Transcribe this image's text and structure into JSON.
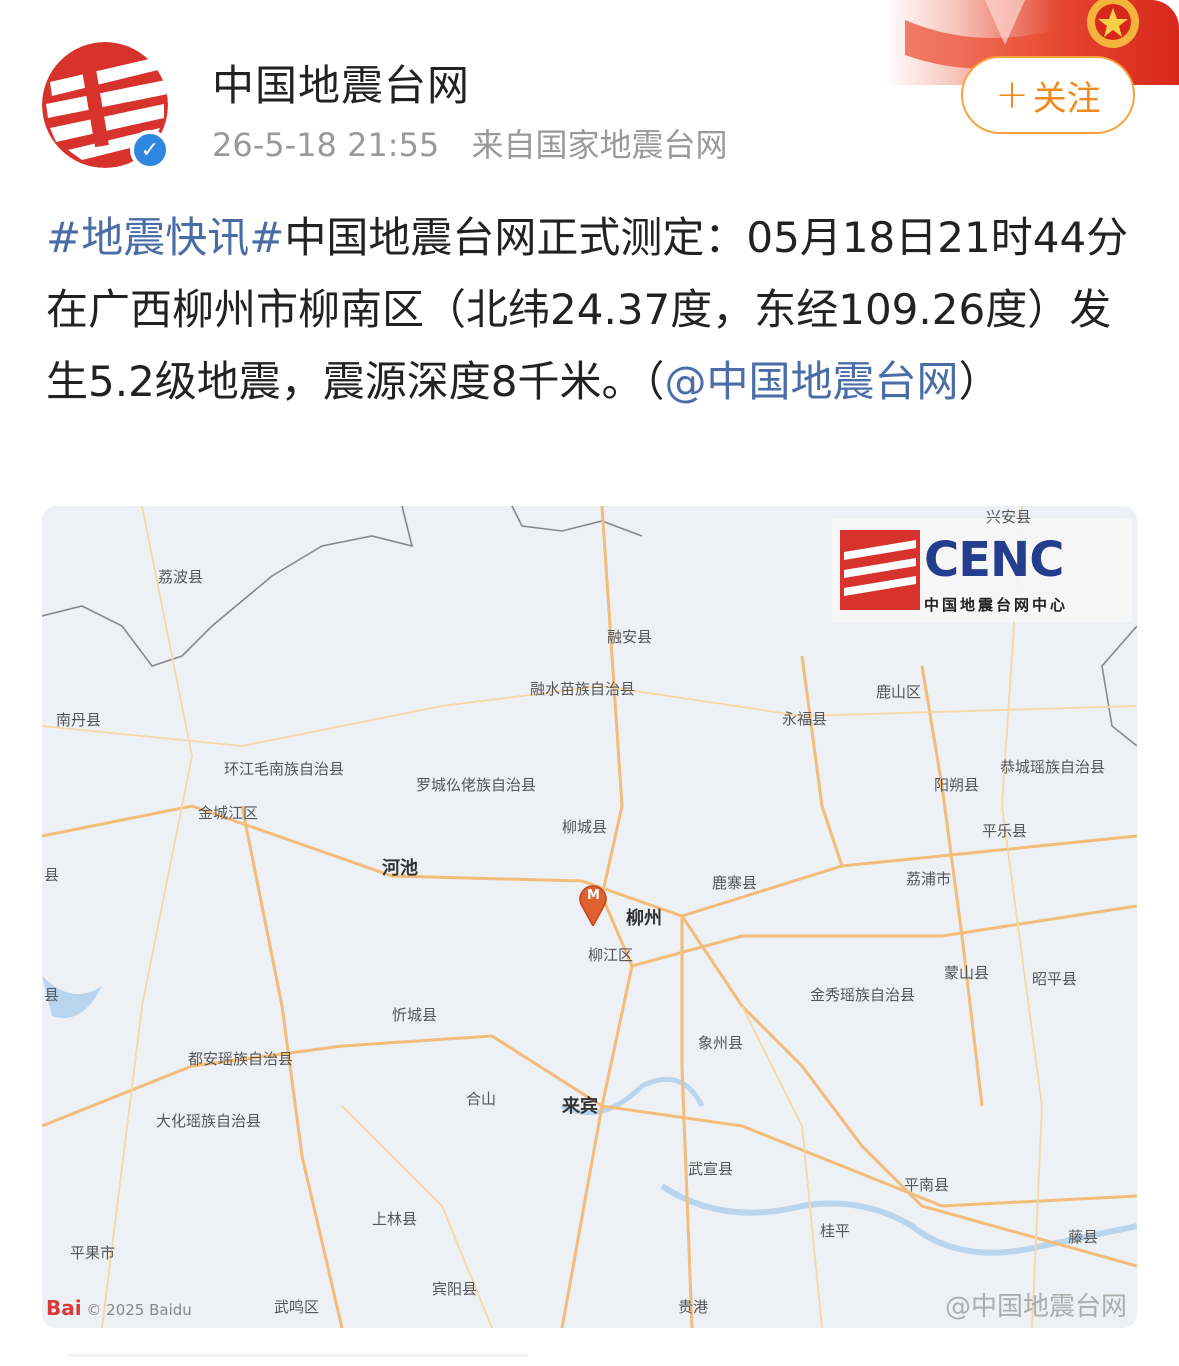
{
  "account": {
    "name": "中国地震台网",
    "verified_icon": "verified-icon",
    "time": "26-5-18 21:55",
    "source": "来自国家地震台网"
  },
  "follow": {
    "plus": "+",
    "label": "关注"
  },
  "post": {
    "hashtag": "#地震快讯#",
    "body": "中国地震台网正式测定：05月18日21时44分在广西柳州市柳南区（北纬24.37度，东经109.26度）发生5.2级地震，震源深度8千米。（",
    "mention": "@中国地震台网",
    "tail": "）"
  },
  "map": {
    "logo_text": "CENC",
    "logo_subtitle": "中国地震台网中心",
    "epicenter_marker": "M",
    "labels": {
      "l1": "荔波县",
      "l2": "融安县",
      "l3": "融水苗族自治县",
      "l4": "鹿山区",
      "l5": "南丹县",
      "l6": "永福县",
      "l7": "环江毛南族自治县",
      "l8": "罗城仫佬族自治县",
      "l9": "阳朔县",
      "l10": "恭城瑶族自治县",
      "l11": "金城江区",
      "l12": "柳城县",
      "l13": "平乐县",
      "l14": "河池",
      "l15": "鹿寨县",
      "l16": "荔浦市",
      "l17": "柳州",
      "l18": "柳江区",
      "l19": "蒙山县",
      "l20": "昭平县",
      "l21": "金秀瑶族自治县",
      "l22": "忻城县",
      "l23": "都安瑶族自治县",
      "l24": "象州县",
      "l25": "合山",
      "l26": "来宾",
      "l27": "大化瑶族自治县",
      "l28": "武宣县",
      "l29": "平南县",
      "l30": "上林县",
      "l31": "桂平",
      "l32": "平果市",
      "l33": "藤县",
      "l34": "宾阳县",
      "l35": "武鸣区",
      "l36": "贵港",
      "l37": "县",
      "l38": "县",
      "l39": "兴安县"
    },
    "baidu_logo": "Bai",
    "baidu_copyright": "© 2025 Baidu",
    "watermark": "@中国地震台网"
  }
}
